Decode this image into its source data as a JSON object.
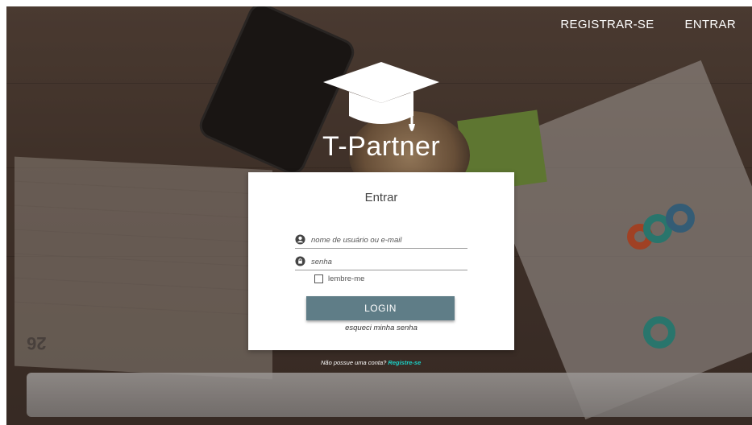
{
  "nav": {
    "register_label": "REGISTRAR-SE",
    "login_label": "ENTRAR"
  },
  "brand": {
    "name": "T-Partner",
    "icon": "graduation-cap-icon"
  },
  "login_card": {
    "title": "Entrar",
    "username_placeholder": "nome de usuário ou e-mail",
    "password_placeholder": "senha",
    "remember_label": "lembre-me",
    "login_button": "LOGIN",
    "forgot_link": "esqueci minha senha"
  },
  "signup": {
    "prompt": "Não possue uma conta?",
    "link": "Registre-se"
  },
  "colors": {
    "button": "#5f7d87",
    "signup_link": "#1bd1c7"
  }
}
